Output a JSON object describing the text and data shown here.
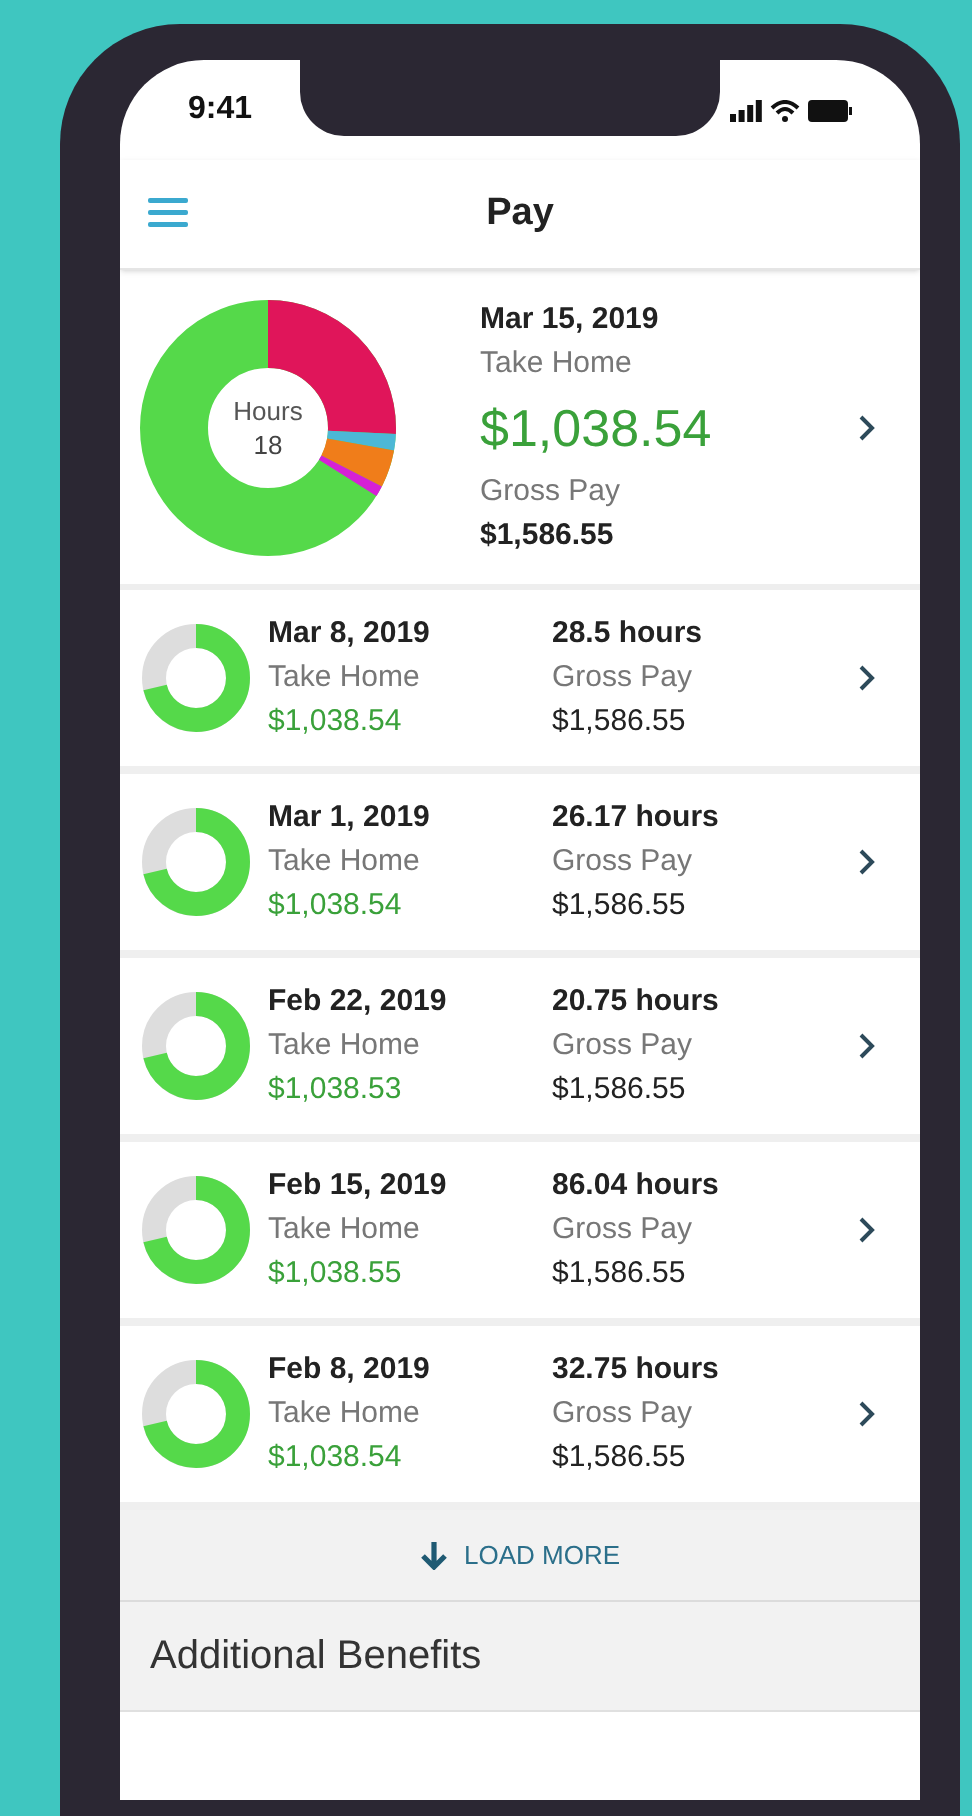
{
  "status_bar": {
    "time": "9:41"
  },
  "nav": {
    "title": "Pay"
  },
  "latest": {
    "date": "Mar 15, 2019",
    "take_home_label": "Take Home",
    "take_home": "$1,038.54",
    "gross_label": "Gross Pay",
    "gross": "$1,586.55",
    "chart_label": "Hours",
    "chart_value": "18"
  },
  "pay_periods": [
    {
      "date": "Mar 8, 2019",
      "take_home_label": "Take Home",
      "take_home": "$1,038.54",
      "hours": "28.5 hours",
      "gross_label": "Gross Pay",
      "gross": "$1,586.55"
    },
    {
      "date": "Mar 1, 2019",
      "take_home_label": "Take Home",
      "take_home": "$1,038.54",
      "hours": "26.17 hours",
      "gross_label": "Gross Pay",
      "gross": "$1,586.55"
    },
    {
      "date": "Feb 22, 2019",
      "take_home_label": "Take Home",
      "take_home": "$1,038.53",
      "hours": "20.75 hours",
      "gross_label": "Gross Pay",
      "gross": "$1,586.55"
    },
    {
      "date": "Feb 15, 2019",
      "take_home_label": "Take Home",
      "take_home": "$1,038.55",
      "hours": "86.04 hours",
      "gross_label": "Gross Pay",
      "gross": "$1,586.55"
    },
    {
      "date": "Feb 8, 2019",
      "take_home_label": "Take Home",
      "take_home": "$1,038.54",
      "hours": "32.75 hours",
      "gross_label": "Gross Pay",
      "gross": "$1,586.55"
    }
  ],
  "load_more": "LOAD MORE",
  "section_title": "Additional Benefits"
}
